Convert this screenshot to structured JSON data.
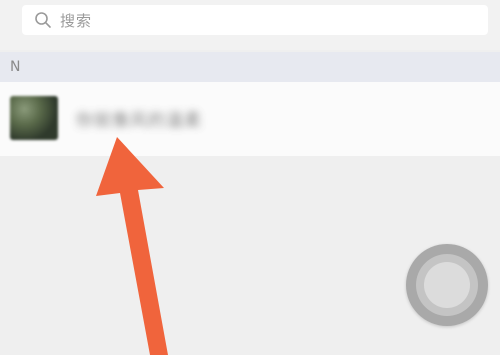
{
  "search": {
    "icon": "search-icon",
    "placeholder": "搜索"
  },
  "section": {
    "letter": "N"
  },
  "contact": {
    "name": "你就像风的温柔"
  },
  "colors": {
    "arrow": "#f0643c",
    "section_bg": "#e7e9f0",
    "page_bg": "#efefef"
  }
}
